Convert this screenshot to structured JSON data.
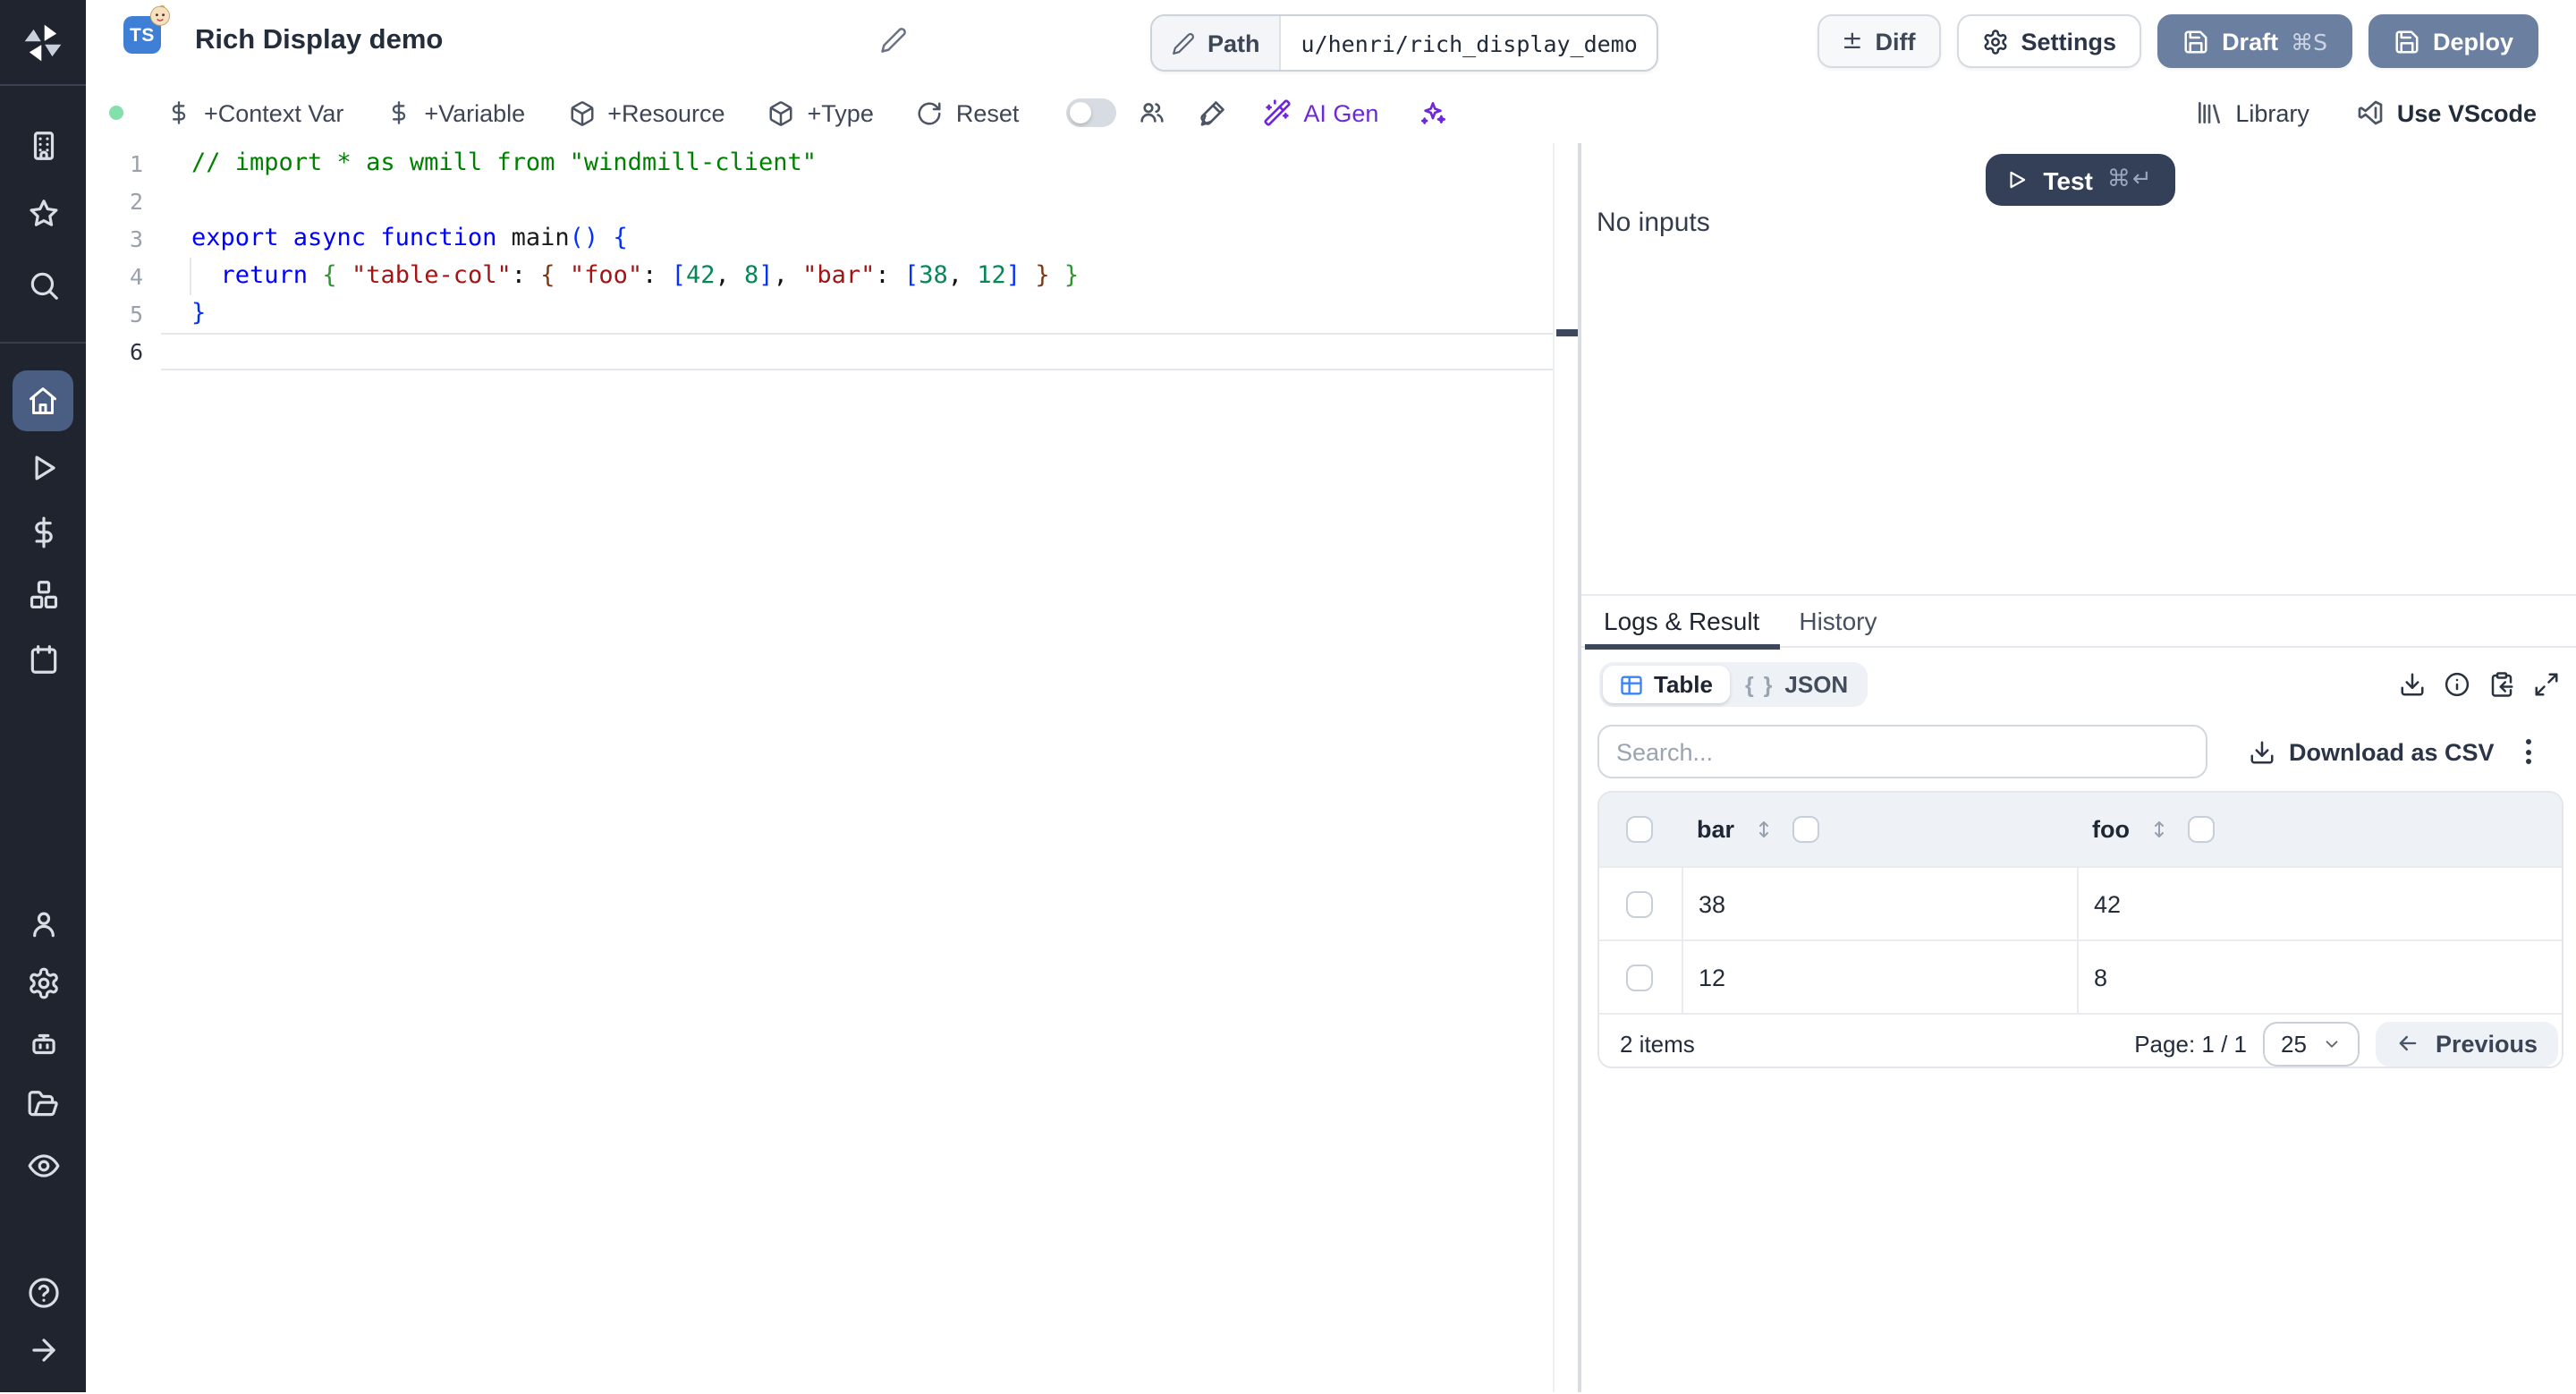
{
  "header": {
    "language_badge": "TS",
    "title": "Rich Display demo",
    "path_label": "Path",
    "path_value": "u/henri/rich_display_demo",
    "diff_label": "Diff",
    "diff_glyph": "±",
    "settings_label": "Settings",
    "draft_label": "Draft",
    "draft_shortcut": "⌘S",
    "deploy_label": "Deploy"
  },
  "toolbar": {
    "context_var_label": "+Context Var",
    "variable_label": "+Variable",
    "resource_label": "+Resource",
    "type_label": "+Type",
    "reset_label": "Reset",
    "ai_gen_label": "AI Gen",
    "library_label": "Library",
    "vscode_label": "Use VScode"
  },
  "sidebar": {
    "top_icons": [
      "building",
      "star",
      "search"
    ],
    "active_item": "home",
    "main_icons": [
      "home",
      "play",
      "dollar-sign",
      "boxes",
      "calendar"
    ],
    "lower_icons": [
      "user",
      "settings-gear",
      "robot",
      "folder-open",
      "eye"
    ],
    "bottom_icons": [
      "help-circle",
      "arrow-right"
    ]
  },
  "editor": {
    "lines": [
      {
        "n": "1",
        "tokens": [
          [
            "cm",
            "// import * as wmill from \"windmill-client\""
          ]
        ]
      },
      {
        "n": "2",
        "tokens": []
      },
      {
        "n": "3",
        "tokens": [
          [
            "kw",
            "export async function"
          ],
          [
            "id",
            " main"
          ],
          [
            "b1",
            "()"
          ],
          [
            "pl",
            " "
          ],
          [
            "b1",
            "{"
          ]
        ]
      },
      {
        "n": "4",
        "guide": true,
        "tokens": [
          [
            "pl",
            "  "
          ],
          [
            "kw",
            "return"
          ],
          [
            "pl",
            " "
          ],
          [
            "b2",
            "{"
          ],
          [
            "pl",
            " "
          ],
          [
            "st",
            "\"table-col\""
          ],
          [
            "pl",
            ": "
          ],
          [
            "b3",
            "{"
          ],
          [
            "pl",
            " "
          ],
          [
            "st",
            "\"foo\""
          ],
          [
            "pl",
            ": "
          ],
          [
            "b1",
            "["
          ],
          [
            "nu",
            "42"
          ],
          [
            "pl",
            ", "
          ],
          [
            "nu",
            "8"
          ],
          [
            "b1",
            "]"
          ],
          [
            "pl",
            ", "
          ],
          [
            "st",
            "\"bar\""
          ],
          [
            "pl",
            ": "
          ],
          [
            "b1",
            "["
          ],
          [
            "nu",
            "38"
          ],
          [
            "pl",
            ", "
          ],
          [
            "nu",
            "12"
          ],
          [
            "b1",
            "]"
          ],
          [
            "pl",
            " "
          ],
          [
            "b3",
            "}"
          ],
          [
            "pl",
            " "
          ],
          [
            "b2",
            "}"
          ]
        ]
      },
      {
        "n": "5",
        "tokens": [
          [
            "b1",
            "}"
          ]
        ]
      },
      {
        "n": "6",
        "current": true,
        "tokens": []
      }
    ]
  },
  "preview": {
    "test_label": "Test",
    "test_shortcut": "⌘↵",
    "no_inputs": "No inputs"
  },
  "result_panel": {
    "tabs": [
      {
        "label": "Logs & Result",
        "active": true
      },
      {
        "label": "History",
        "active": false
      }
    ],
    "view_toggle": {
      "table_label": "Table",
      "json_label": "JSON",
      "json_glyph": "{ }"
    },
    "search_placeholder": "Search...",
    "download_csv_label": "Download as CSV",
    "table": {
      "columns": [
        "bar",
        "foo"
      ],
      "rows": [
        [
          "38",
          "42"
        ],
        [
          "12",
          "8"
        ]
      ],
      "items_label": "2 items",
      "page_label": "Page: 1 / 1",
      "page_size": "25",
      "previous_label": "Previous"
    }
  },
  "colors": {
    "accent_blue": "#3b82f6",
    "ai_purple": "#6d28d9",
    "draft_deploy_button": "#6b80a1",
    "test_button": "#343f58",
    "status_green": "#84e0aa",
    "sidebar_bg": "#20242e",
    "sidebar_active": "#4a5d82"
  }
}
